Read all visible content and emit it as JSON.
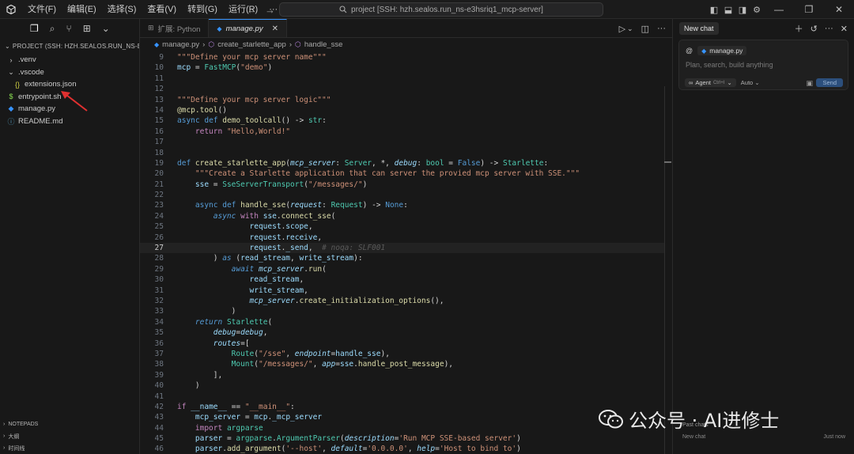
{
  "menu": [
    "文件(F)",
    "编辑(E)",
    "选择(S)",
    "查看(V)",
    "转到(G)",
    "运行(R)",
    "···"
  ],
  "command_center": "project [SSH: hzh.sealos.run_ns-e3hsriq1_mcp-server]",
  "explorer": {
    "header": "PROJECT (SSH: HZH.SEALOS.RUN_NS-E3H...",
    "items": [
      {
        "label": ".venv",
        "kind": "folder-closed",
        "indent": 0
      },
      {
        "label": ".vscode",
        "kind": "folder-open",
        "indent": 0
      },
      {
        "label": "extensions.json",
        "kind": "json",
        "indent": 1
      },
      {
        "label": "entrypoint.sh",
        "kind": "shell",
        "indent": 0
      },
      {
        "label": "manage.py",
        "kind": "python",
        "indent": 0
      },
      {
        "label": "README.md",
        "kind": "info",
        "indent": 0
      }
    ],
    "footer": [
      "NOTEPADS",
      "大纲",
      "时间线"
    ]
  },
  "tabs": [
    {
      "label": "扩展: Python",
      "active": false
    },
    {
      "label": "manage.py",
      "active": true
    }
  ],
  "breadcrumbs": [
    "manage.py",
    "create_starlette_app",
    "handle_sse"
  ],
  "code_lines": [
    {
      "n": "9",
      "html": "<span class=\"st\">\"\"\"Define your mcp server name\"\"\"</span>"
    },
    {
      "n": "10",
      "html": "<span class=\"va\">mcp</span> = <span class=\"cl\">FastMCP</span>(<span class=\"st\">\"demo\"</span>)"
    },
    {
      "n": "11",
      "html": ""
    },
    {
      "n": "12",
      "html": ""
    },
    {
      "n": "13",
      "html": "<span class=\"st\">\"\"\"Define your mcp server logic\"\"\"</span>"
    },
    {
      "n": "14",
      "html": "<span class=\"dec\">@mcp.tool</span>()"
    },
    {
      "n": "15",
      "html": "<span class=\"kw\">async</span> <span class=\"kw\">def</span> <span class=\"fn\">demo_toolcall</span>() -> <span class=\"cl\">str</span>:"
    },
    {
      "n": "16",
      "html": "    <span class=\"k\">return</span> <span class=\"st\">\"Hello,World!\"</span>"
    },
    {
      "n": "17",
      "html": ""
    },
    {
      "n": "18",
      "html": ""
    },
    {
      "n": "19",
      "html": "<span class=\"kw\">def</span> <span class=\"fn\">create_starlette_app</span>(<span class=\"pa\">mcp_server</span>: <span class=\"cl\">Server</span>, *, <span class=\"pa\">debug</span>: <span class=\"cl\">bool</span> = <span class=\"kw\">False</span>) -> <span class=\"cl\">Starlette</span>:"
    },
    {
      "n": "20",
      "html": "    <span class=\"st\">\"\"\"Create a Starlette application that can server the provied mcp server with SSE.\"\"\"</span>"
    },
    {
      "n": "21",
      "html": "    <span class=\"va\">sse</span> = <span class=\"cl\">SseServerTransport</span>(<span class=\"st\">\"/messages/\"</span>)"
    },
    {
      "n": "22",
      "html": ""
    },
    {
      "n": "23",
      "html": "    <span class=\"kw\">async</span> <span class=\"kw\">def</span> <span class=\"fn\">handle_sse</span>(<span class=\"pa\">request</span>: <span class=\"cl\">Request</span>) -> <span class=\"kw\">None</span>:"
    },
    {
      "n": "24",
      "html": "        <span class=\"kwi\">async</span> <span class=\"k\">with</span> <span class=\"va\">sse</span>.<span class=\"fn\">connect_sse</span>("
    },
    {
      "n": "25",
      "html": "                <span class=\"va\">request</span>.<span class=\"va\">scope</span>,"
    },
    {
      "n": "26",
      "html": "                <span class=\"va\">request</span>.<span class=\"va\">receive</span>,"
    },
    {
      "n": "27",
      "html": "                <span class=\"va\">request</span>.<span class=\"va\">_send</span>,  <span class=\"ghost\"># noqa: SLF001</span>",
      "current": true
    },
    {
      "n": "28",
      "html": "        ) <span class=\"kwi\">as</span> (<span class=\"va\">read_stream</span>, <span class=\"va\">write_stream</span>):"
    },
    {
      "n": "29",
      "html": "            <span class=\"kwi\">await</span> <span class=\"pa\">mcp_server</span>.<span class=\"fn\">run</span>("
    },
    {
      "n": "30",
      "html": "                <span class=\"va\">read_stream</span>,"
    },
    {
      "n": "31",
      "html": "                <span class=\"va\">write_stream</span>,"
    },
    {
      "n": "32",
      "html": "                <span class=\"pa\">mcp_server</span>.<span class=\"fn\">create_initialization_options</span>(),"
    },
    {
      "n": "33",
      "html": "            )"
    },
    {
      "n": "34",
      "html": "    <span class=\"kwi\">return</span> <span class=\"cl\">Starlette</span>("
    },
    {
      "n": "35",
      "html": "        <span class=\"pa\">debug</span>=<span class=\"pa\">debug</span>,"
    },
    {
      "n": "36",
      "html": "        <span class=\"pa\">routes</span>=["
    },
    {
      "n": "37",
      "html": "            <span class=\"cl\">Route</span>(<span class=\"st\">\"/sse\"</span>, <span class=\"pa\">endpoint</span>=<span class=\"va\">handle_sse</span>),"
    },
    {
      "n": "38",
      "html": "            <span class=\"cl\">Mount</span>(<span class=\"st\">\"/messages/\"</span>, <span class=\"pa\">app</span>=<span class=\"va\">sse</span>.<span class=\"fn\">handle_post_message</span>),"
    },
    {
      "n": "39",
      "html": "        ],"
    },
    {
      "n": "40",
      "html": "    )"
    },
    {
      "n": "41",
      "html": ""
    },
    {
      "n": "42",
      "html": "<span class=\"k\">if</span> <span class=\"va\">__name__</span> == <span class=\"st\">\"__main__\"</span>:"
    },
    {
      "n": "43",
      "html": "    <span class=\"va\">mcp_server</span> = <span class=\"va\">mcp</span>.<span class=\"va\">_mcp_server</span>"
    },
    {
      "n": "44",
      "html": "    <span class=\"k\">import</span> <span class=\"cl\">argparse</span>"
    },
    {
      "n": "45",
      "html": "    <span class=\"va\">parser</span> = <span class=\"cl\">argparse</span>.<span class=\"cl\">ArgumentParser</span>(<span class=\"pa\">description</span>=<span class=\"st\">'Run MCP SSE-based server'</span>)"
    },
    {
      "n": "46",
      "html": "    <span class=\"va\">parser</span>.<span class=\"fn\">add_argument</span>(<span class=\"st\">'--host'</span>, <span class=\"pa\">default</span>=<span class=\"st\">'0.0.0.0'</span>, <span class=\"pa\">help</span>=<span class=\"st\">'Host to bind to'</span>)"
    }
  ],
  "chat": {
    "tab": "New chat",
    "context_file": "manage.py",
    "placeholder": "Plan, search, build anything",
    "mode": "Agent",
    "mode_shortcut": "Ctrl+I",
    "model": "Auto",
    "send": "Send",
    "past_chats": "Past chats",
    "history_item": "New chat",
    "history_time": "Just now"
  },
  "watermark": "公众号 · AI进修士",
  "colors": {
    "accent": "#3794ff",
    "annotation_arrow": "#e03030"
  }
}
